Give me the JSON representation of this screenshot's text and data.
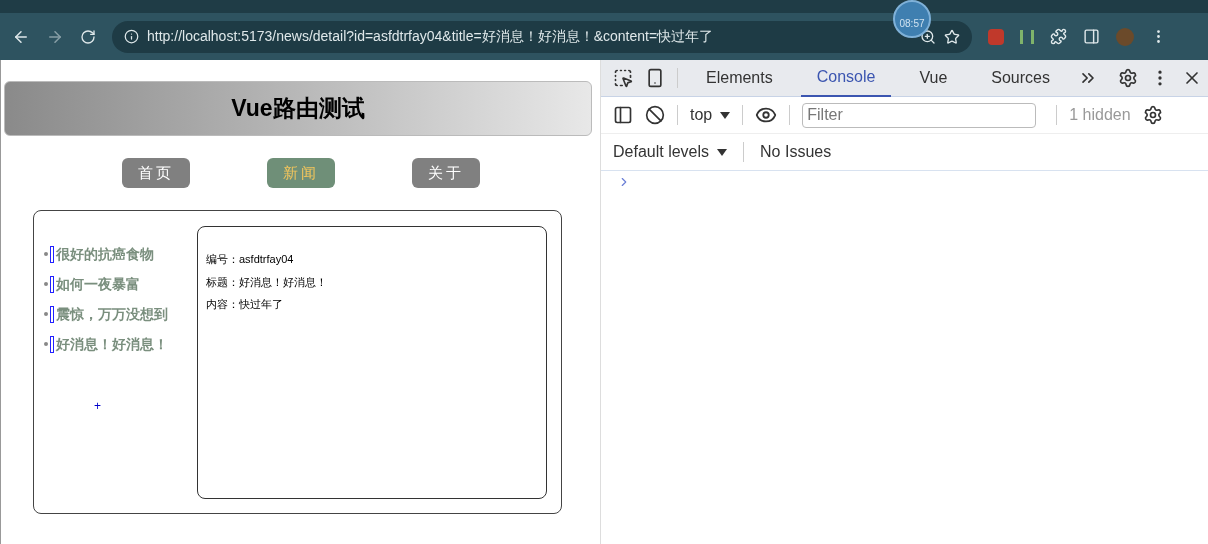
{
  "browser": {
    "url": "http://localhost:5173/news/detail?id=asfdtrfay04&title=好消息！好消息！&content=快过年了",
    "clock": "08:57"
  },
  "page": {
    "title": "Vue路由测试",
    "nav": [
      {
        "label": "首页",
        "selected": false
      },
      {
        "label": "新闻",
        "selected": true
      },
      {
        "label": "关于",
        "selected": false
      }
    ],
    "news": [
      "很好的抗癌食物",
      "如何一夜暴富",
      "震惊，万万没想到",
      "好消息！好消息！"
    ],
    "plus": "+",
    "detail": [
      "编号：asfdtrfay04",
      "标题：好消息！好消息！",
      "内容：快过年了"
    ]
  },
  "devtools": {
    "tabs": [
      {
        "label": "Elements",
        "selected": false
      },
      {
        "label": "Console",
        "selected": true
      },
      {
        "label": "Vue",
        "selected": false
      },
      {
        "label": "Sources",
        "selected": false
      }
    ],
    "context": "top",
    "filter_placeholder": "Filter",
    "hidden": "1 hidden",
    "levels": "Default levels",
    "issues": "No Issues"
  }
}
